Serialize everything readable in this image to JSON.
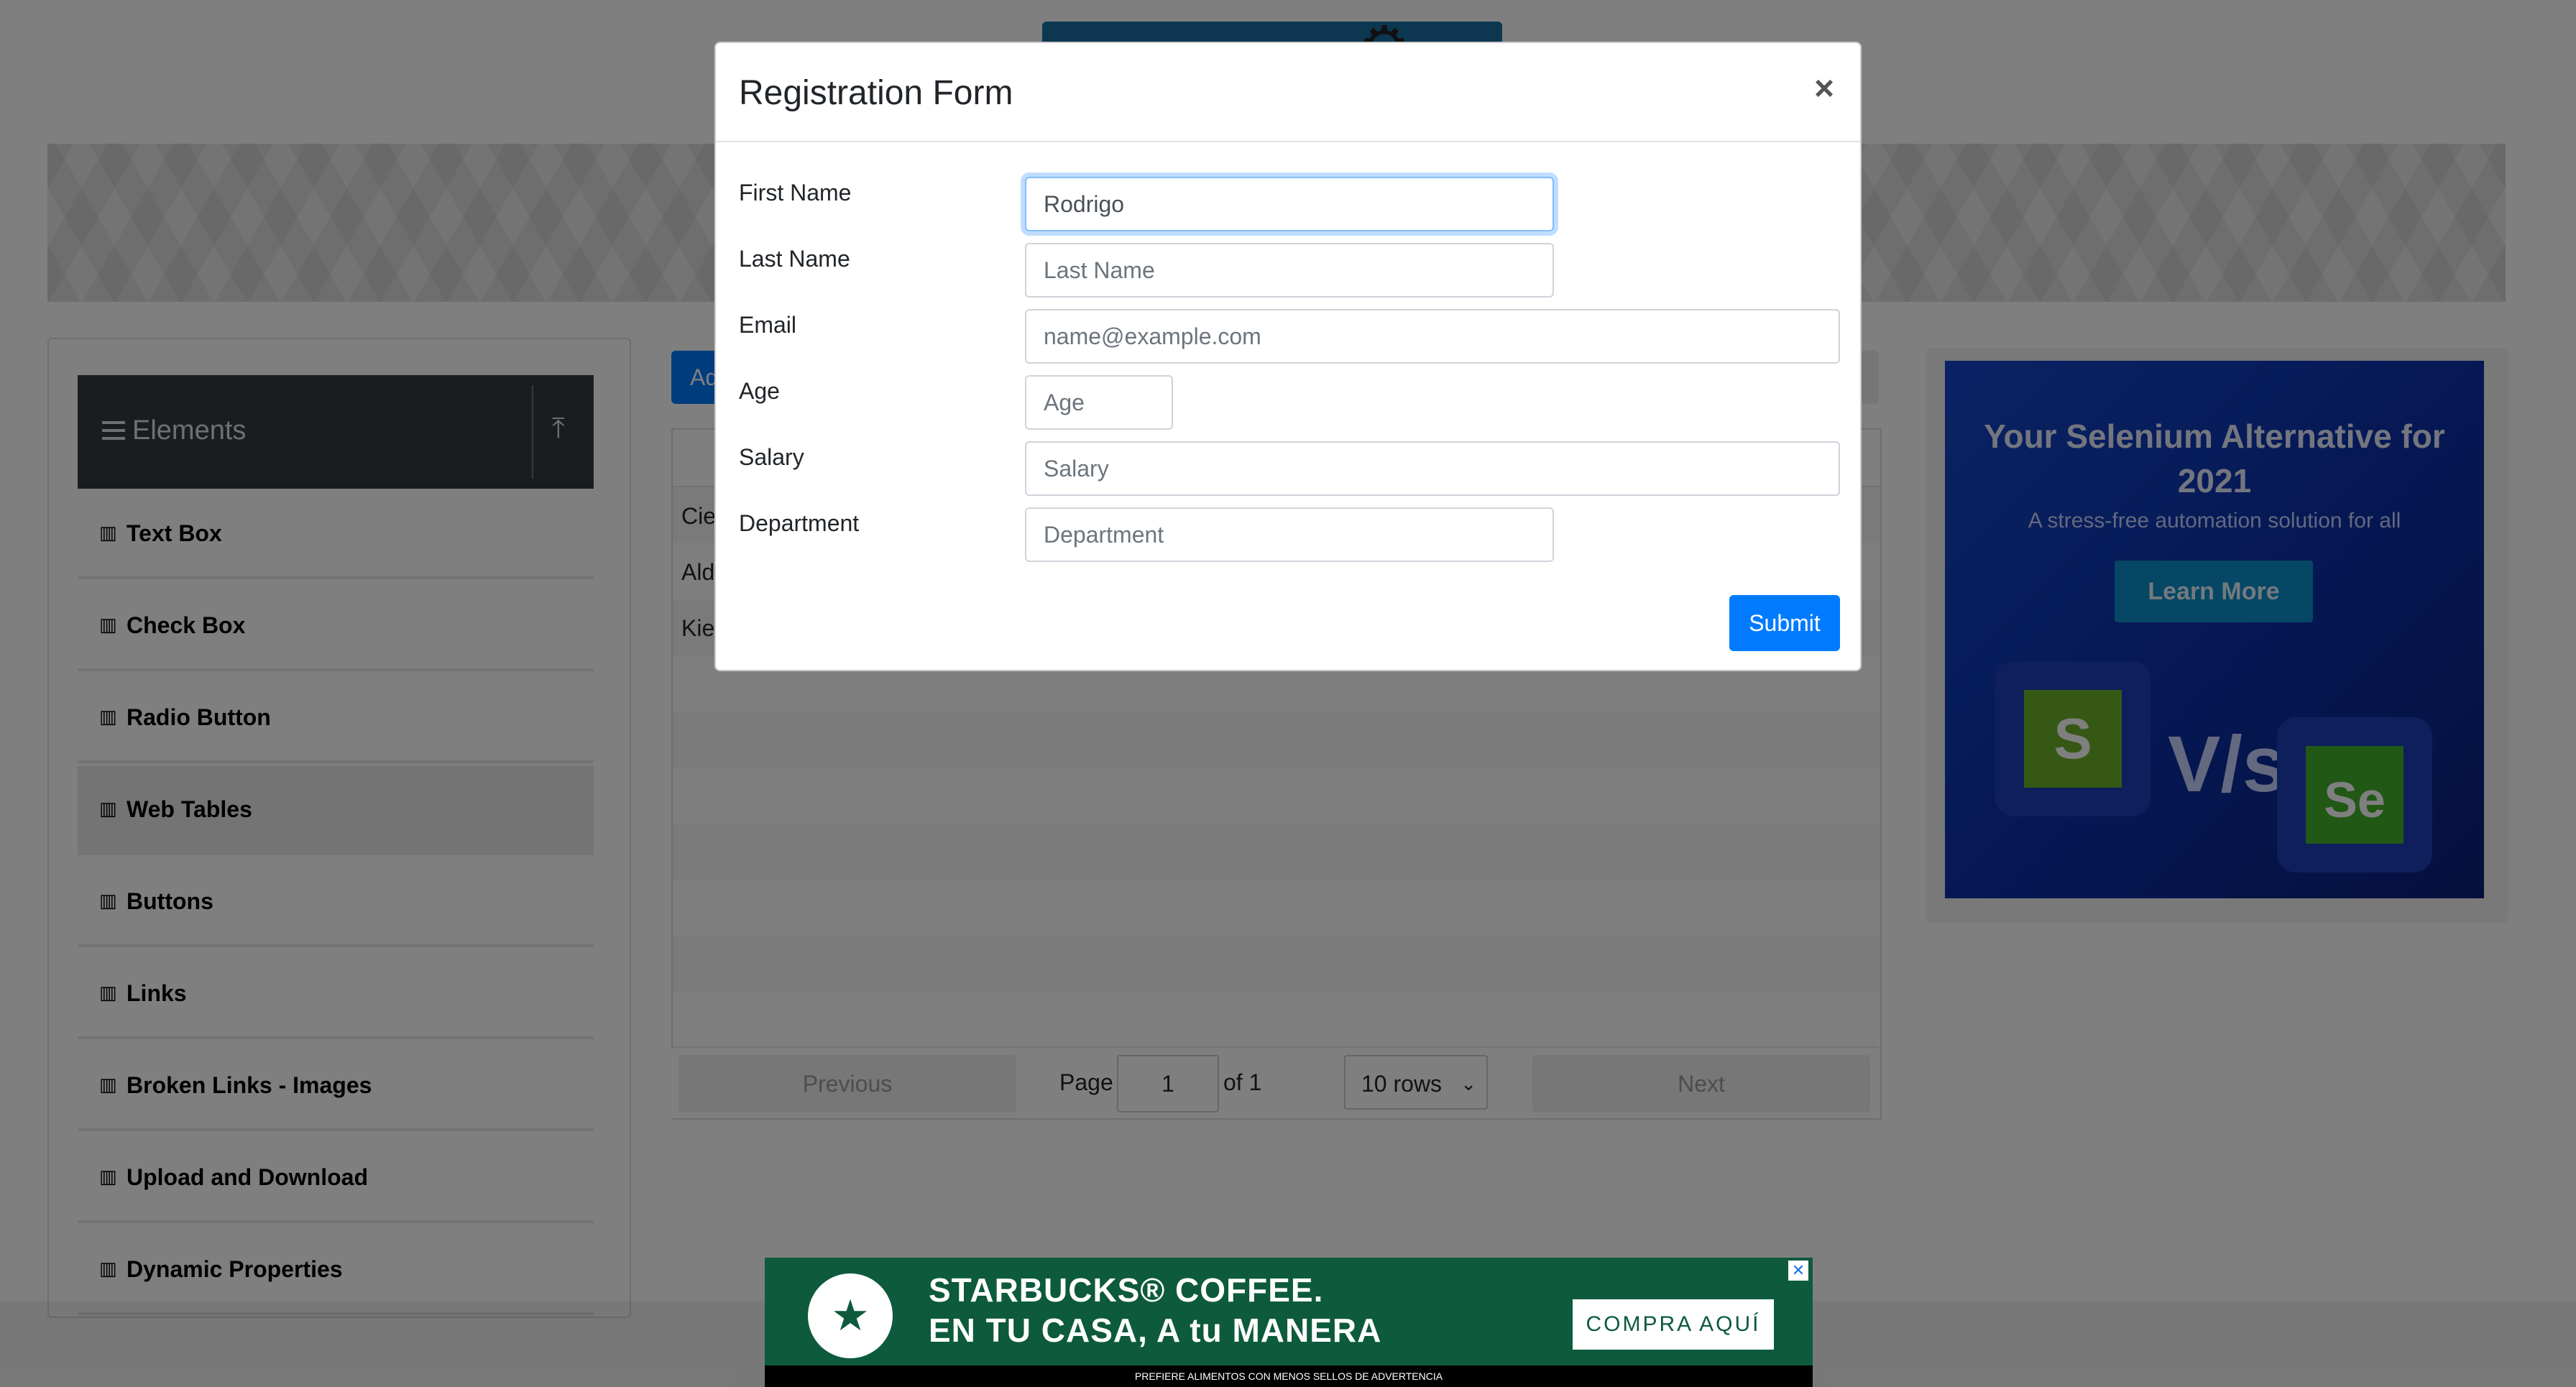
{
  "sidebar": {
    "header": "Elements",
    "items": [
      {
        "label": "Text Box"
      },
      {
        "label": "Check Box"
      },
      {
        "label": "Radio Button"
      },
      {
        "label": "Web Tables"
      },
      {
        "label": "Buttons"
      },
      {
        "label": "Links"
      },
      {
        "label": "Broken Links - Images"
      },
      {
        "label": "Upload and Download"
      },
      {
        "label": "Dynamic Properties"
      }
    ]
  },
  "webtable": {
    "add_label": "Add",
    "rows": [
      {
        "first": "Cierra"
      },
      {
        "first": "Alden"
      },
      {
        "first": "Kierra"
      }
    ]
  },
  "pagination": {
    "previous": "Previous",
    "page_label": "Page",
    "page_value": "1",
    "of_label": "of 1",
    "rows_select": "10 rows",
    "next": "Next"
  },
  "ad_right": {
    "title": "Your Selenium Alternative for 2021",
    "subtitle": "A stress-free automation solution for all",
    "button": "Learn More",
    "vs": "V/s",
    "logo_left": "S",
    "logo_right": "Se"
  },
  "ad_bottom": {
    "line1": "STARBUCKS® COFFEE.",
    "line2": "EN TU CASA, A tu MANERA",
    "button": "COMPRA AQUÍ",
    "footer": "PREFIERE ALIMENTOS CON MENOS SELLOS DE ADVERTENCIA"
  },
  "modal": {
    "title": "Registration Form",
    "close": "×",
    "fields": {
      "first_name": {
        "label": "First Name",
        "value": "Rodrigo",
        "placeholder": "First Name"
      },
      "last_name": {
        "label": "Last Name",
        "value": "",
        "placeholder": "Last Name"
      },
      "email": {
        "label": "Email",
        "value": "",
        "placeholder": "name@example.com"
      },
      "age": {
        "label": "Age",
        "value": "",
        "placeholder": "Age"
      },
      "salary": {
        "label": "Salary",
        "value": "",
        "placeholder": "Salary"
      },
      "department": {
        "label": "Department",
        "value": "",
        "placeholder": "Department"
      }
    },
    "submit": "Submit"
  },
  "colors": {
    "primary": "#007bff",
    "sidebar_header": "#343a40",
    "backdrop": "rgba(0,0,0,0.5)"
  }
}
